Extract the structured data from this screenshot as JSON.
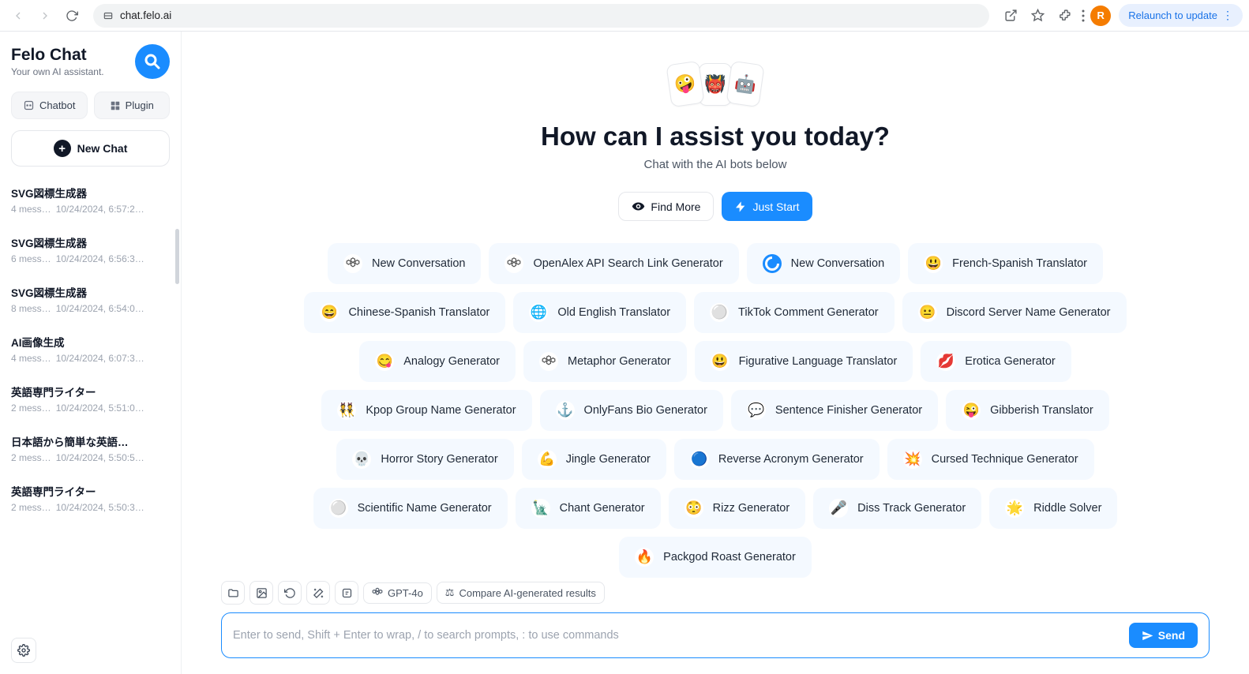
{
  "browser": {
    "url": "chat.felo.ai",
    "avatar_letter": "R",
    "relaunch_label": "Relaunch to update"
  },
  "sidebar": {
    "brand_title": "Felo Chat",
    "brand_subtitle": "Your own AI assistant.",
    "tabs": {
      "chatbot": "Chatbot",
      "plugin": "Plugin"
    },
    "new_chat": "New Chat",
    "chats": [
      {
        "title": "SVG図標生成器",
        "messages": "4 mess…",
        "time": "10/24/2024, 6:57:2…"
      },
      {
        "title": "SVG図標生成器",
        "messages": "6 mess…",
        "time": "10/24/2024, 6:56:3…"
      },
      {
        "title": "SVG図標生成器",
        "messages": "8 mess…",
        "time": "10/24/2024, 6:54:0…"
      },
      {
        "title": "AI画像生成",
        "messages": "4 mess…",
        "time": "10/24/2024, 6:07:3…"
      },
      {
        "title": "英語専門ライター",
        "messages": "2 mess…",
        "time": "10/24/2024, 5:51:0…"
      },
      {
        "title": "日本語から簡単な英語…",
        "messages": "2 mess…",
        "time": "10/24/2024, 5:50:5…"
      },
      {
        "title": "英語専門ライター",
        "messages": "2 mess…",
        "time": "10/24/2024, 5:50:3…"
      }
    ]
  },
  "main": {
    "emojis": [
      "🤪",
      "👹",
      "🤖"
    ],
    "headline": "How can I assist you today?",
    "subhead": "Chat with the AI bots below",
    "find_more": "Find More",
    "just_start": "Just Start",
    "bots": [
      {
        "icon": "openai",
        "label": "New Conversation"
      },
      {
        "icon": "openai",
        "label": "OpenAlex API Search Link Generator"
      },
      {
        "icon": "blue-swirl",
        "label": "New Conversation"
      },
      {
        "icon": "😃",
        "label": "French-Spanish Translator"
      },
      {
        "icon": "😄",
        "label": "Chinese-Spanish Translator"
      },
      {
        "icon": "🌐",
        "label": "Old English Translator"
      },
      {
        "icon": "⚪",
        "label": "TikTok Comment Generator"
      },
      {
        "icon": "😐",
        "label": "Discord Server Name Generator"
      },
      {
        "icon": "😋",
        "label": "Analogy Generator"
      },
      {
        "icon": "openai",
        "label": "Metaphor Generator"
      },
      {
        "icon": "😃",
        "label": "Figurative Language Translator"
      },
      {
        "icon": "💋",
        "label": "Erotica Generator"
      },
      {
        "icon": "👯",
        "label": "Kpop Group Name Generator"
      },
      {
        "icon": "⚓",
        "label": "OnlyFans Bio Generator"
      },
      {
        "icon": "💬",
        "label": "Sentence Finisher Generator"
      },
      {
        "icon": "😜",
        "label": "Gibberish Translator"
      },
      {
        "icon": "💀",
        "label": "Horror Story Generator"
      },
      {
        "icon": "💪",
        "label": "Jingle Generator"
      },
      {
        "icon": "🔵",
        "label": "Reverse Acronym Generator"
      },
      {
        "icon": "💥",
        "label": "Cursed Technique Generator"
      },
      {
        "icon": "⚪",
        "label": "Scientific Name Generator"
      },
      {
        "icon": "🗽",
        "label": "Chant Generator"
      },
      {
        "icon": "😳",
        "label": "Rizz Generator"
      },
      {
        "icon": "🎤",
        "label": "Diss Track Generator"
      },
      {
        "icon": "🌟",
        "label": "Riddle Solver"
      },
      {
        "icon": "🔥",
        "label": "Packgod Roast Generator"
      }
    ]
  },
  "composer": {
    "model_label": "GPT-4o",
    "compare_label": "Compare AI-generated results",
    "placeholder": "Enter to send, Shift + Enter to wrap, / to search prompts, : to use commands",
    "send": "Send"
  }
}
